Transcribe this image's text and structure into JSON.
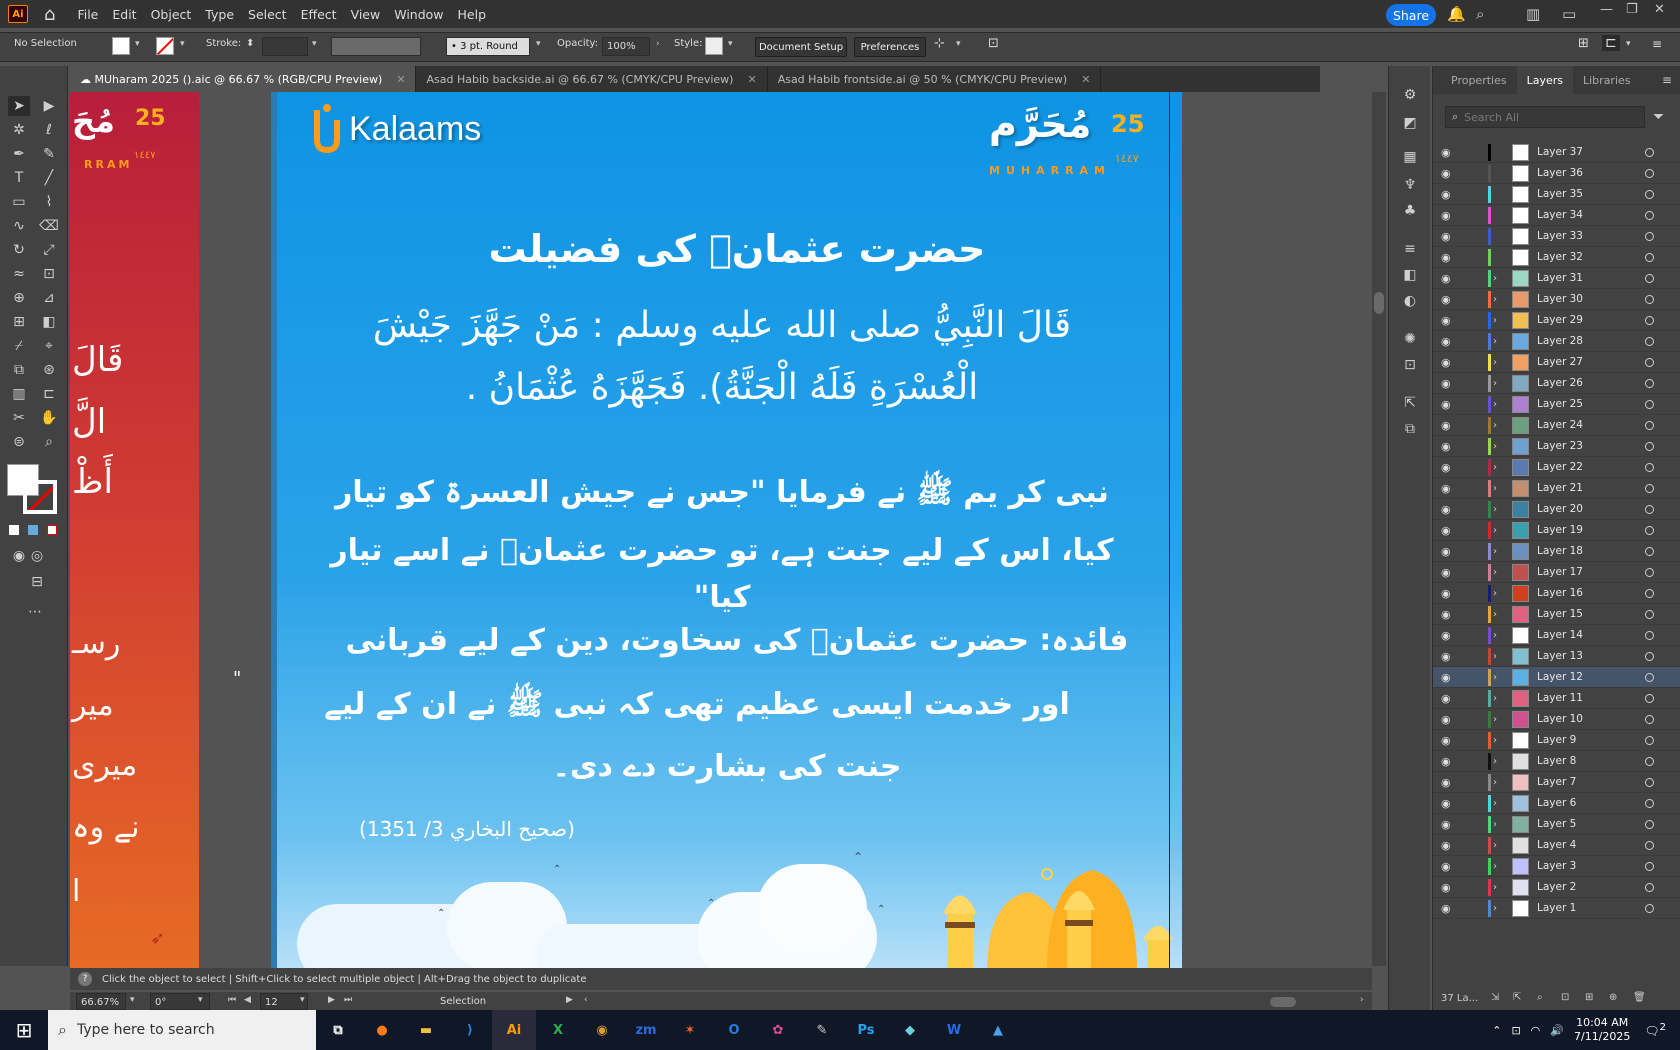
{
  "menubar": {
    "app_icon": "Ai",
    "items": [
      "File",
      "Edit",
      "Object",
      "Type",
      "Select",
      "Effect",
      "View",
      "Window",
      "Help"
    ],
    "share_label": "Share"
  },
  "control": {
    "selection_label": "No Selection",
    "stroke_label": "Stroke:",
    "brush_label": "3 pt. Round",
    "opacity_label": "Opacity:",
    "opacity_value": "100%",
    "style_label": "Style:",
    "document_setup": "Document Setup",
    "preferences": "Preferences"
  },
  "tabs": [
    {
      "label": "MUharam 2025 ().aic @ 66.67 % (RGB/CPU Preview)",
      "active": true
    },
    {
      "label": "Asad Habib backside.ai @ 66.67 % (CMYK/CPU Preview)",
      "active": false
    },
    {
      "label": "Asad Habib frontside.ai @ 50 % (CMYK/CPU Preview)",
      "active": false
    }
  ],
  "artboard": {
    "logo_text": "Kalaams",
    "badge_number": "25",
    "badge_word": "MUHARRAM",
    "badge_year": "١٤٤٧",
    "title": "حضرت عثمانؓ کی فضیلت",
    "arabic_line1": "قَالَ النَّبِيُّ صلى الله عليه وسلم : مَنْ جَهَّزَ جَيْشَ",
    "arabic_line2": "الْعُسْرَةِ فَلَهُ الْجَنَّةُ). فَجَهَّزَهُ عُثْمَانُ .",
    "urdu_line1": "نبی کر یم ﷺ نے فرمایا \"جس نے جیش العسرۃ کو تیار",
    "urdu_line2": "کیا، اس کے لیے جنت ہے، تو حضرت عثمانؓ نے اسے تیار کیا\"",
    "fayda_line1": "فائدہ: حضرت عثمانؓ کی سخاوت، دین کے لیے قربانی",
    "fayda_line2": "اور خدمت ایسی عظیم تھی کہ نبی ﷺ نے ان کے لیے",
    "fayda_line3": "جنت کی بشارت دے دی۔",
    "reference": "(صحيح البخاري 3/ 1351)"
  },
  "leftboard": {
    "badge_number": "25",
    "badge_word": "RRAM",
    "badge_year": "١٤٤٧",
    "lines": [
      "قَالَ",
      "الَّ",
      "أَظْ",
      "رسـ",
      "میر",
      "میری",
      "نے وہ",
      "ا"
    ]
  },
  "panel": {
    "tabs": [
      "Properties",
      "Layers",
      "Libraries"
    ],
    "active_tab": "Layers",
    "search_placeholder": "Search All",
    "layers": [
      {
        "name": "Layer 37",
        "color": "#000000",
        "expandable": false,
        "thumb": "#ffffff"
      },
      {
        "name": "Layer 36",
        "color": "#555555",
        "expandable": false,
        "thumb": "#ffffff"
      },
      {
        "name": "Layer 35",
        "color": "#4fd6e6",
        "expandable": false,
        "thumb": "#ffffff"
      },
      {
        "name": "Layer 34",
        "color": "#e04fd6",
        "expandable": false,
        "thumb": "#ffffff"
      },
      {
        "name": "Layer 33",
        "color": "#3a5ad6",
        "expandable": false,
        "thumb": "#ffffff"
      },
      {
        "name": "Layer 32",
        "color": "#6ad64f",
        "expandable": false,
        "thumb": "#ffffff"
      },
      {
        "name": "Layer 31",
        "color": "#4fd67a",
        "expandable": true,
        "thumb": "#9ad7c4"
      },
      {
        "name": "Layer 30",
        "color": "#ff6a3a",
        "expandable": true,
        "thumb": "#e89b6a"
      },
      {
        "name": "Layer 29",
        "color": "#1f6be0",
        "expandable": true,
        "thumb": "#f0c050"
      },
      {
        "name": "Layer 28",
        "color": "#4a7ae0",
        "expandable": true,
        "thumb": "#6aa8e0"
      },
      {
        "name": "Layer 27",
        "color": "#f0e04f",
        "expandable": true,
        "thumb": "#f0a060"
      },
      {
        "name": "Layer 26",
        "color": "#9a9a9a",
        "expandable": true,
        "thumb": "#80a8c0"
      },
      {
        "name": "Layer 25",
        "color": "#6a4fd6",
        "expandable": true,
        "thumb": "#b080d0"
      },
      {
        "name": "Layer 24",
        "color": "#a07a2a",
        "expandable": true,
        "thumb": "#6aa080"
      },
      {
        "name": "Layer 23",
        "color": "#9ad64f",
        "expandable": true,
        "thumb": "#70a0d0"
      },
      {
        "name": "Layer 22",
        "color": "#b02a4a",
        "expandable": true,
        "thumb": "#5a7ab0"
      },
      {
        "name": "Layer 21",
        "color": "#e07a7a",
        "expandable": true,
        "thumb": "#c09070"
      },
      {
        "name": "Layer 20",
        "color": "#2a8a4a",
        "expandable": true,
        "thumb": "#3a80a0"
      },
      {
        "name": "Layer 19",
        "color": "#d02a2a",
        "expandable": true,
        "thumb": "#3aa0b0"
      },
      {
        "name": "Layer 18",
        "color": "#8a8ad6",
        "expandable": true,
        "thumb": "#6a90c0"
      },
      {
        "name": "Layer 17",
        "color": "#d67aa0",
        "expandable": true,
        "thumb": "#c05050"
      },
      {
        "name": "Layer 16",
        "color": "#1a1a7a",
        "expandable": true,
        "thumb": "#d04020"
      },
      {
        "name": "Layer 15",
        "color": "#f0a03a",
        "expandable": true,
        "thumb": "#e06080"
      },
      {
        "name": "Layer 14",
        "color": "#7a4ad6",
        "expandable": true,
        "thumb": "#ffffff"
      },
      {
        "name": "Layer 13",
        "color": "#c04a2a",
        "expandable": true,
        "thumb": "#80c0d0"
      },
      {
        "name": "Layer 12",
        "color": "#d6a04f",
        "expandable": true,
        "thumb": "#5ab0e0",
        "selected": true
      },
      {
        "name": "Layer 11",
        "color": "#4fb0a0",
        "expandable": true,
        "thumb": "#e06080"
      },
      {
        "name": "Layer 10",
        "color": "#3a7a3a",
        "expandable": true,
        "thumb": "#d05090"
      },
      {
        "name": "Layer 9",
        "color": "#e0602a",
        "expandable": true,
        "thumb": "#ffffff"
      },
      {
        "name": "Layer 8",
        "color": "#101010",
        "expandable": true,
        "thumb": "#e0e0e0"
      },
      {
        "name": "Layer 7",
        "color": "#8a8a8a",
        "expandable": true,
        "thumb": "#f0c0c0"
      },
      {
        "name": "Layer 6",
        "color": "#4fd6e0",
        "expandable": true,
        "thumb": "#a0c0e0"
      },
      {
        "name": "Layer 5",
        "color": "#4fd67a",
        "expandable": true,
        "thumb": "#80b0a0"
      },
      {
        "name": "Layer 4",
        "color": "#d04a4a",
        "expandable": true,
        "thumb": "#e0e0e0"
      },
      {
        "name": "Layer 3",
        "color": "#3ad64f",
        "expandable": true,
        "thumb": "#c0c0ff"
      },
      {
        "name": "Layer 2",
        "color": "#d63a4f",
        "expandable": true,
        "thumb": "#e0e0f0"
      },
      {
        "name": "Layer 1",
        "color": "#4a8ad6",
        "expandable": true,
        "thumb": "#ffffff"
      }
    ],
    "footer_count": "37 La..."
  },
  "status": {
    "hint": "Click the object to select  |  Shift+Click to select multiple object  |  Alt+Drag the object to duplicate",
    "zoom": "66.67%",
    "rotation": "0°",
    "artboard_number": "12",
    "mode": "Selection"
  },
  "taskbar": {
    "search_placeholder": "Type here to search",
    "time": "10:04 AM",
    "date": "7/11/2025",
    "notification_count": "2"
  },
  "colors": {
    "accent": "#1473e6",
    "artboard_top": "#0e94e4",
    "left_artboard": "#c8303a",
    "badge_orange": "#ff9a1a"
  }
}
